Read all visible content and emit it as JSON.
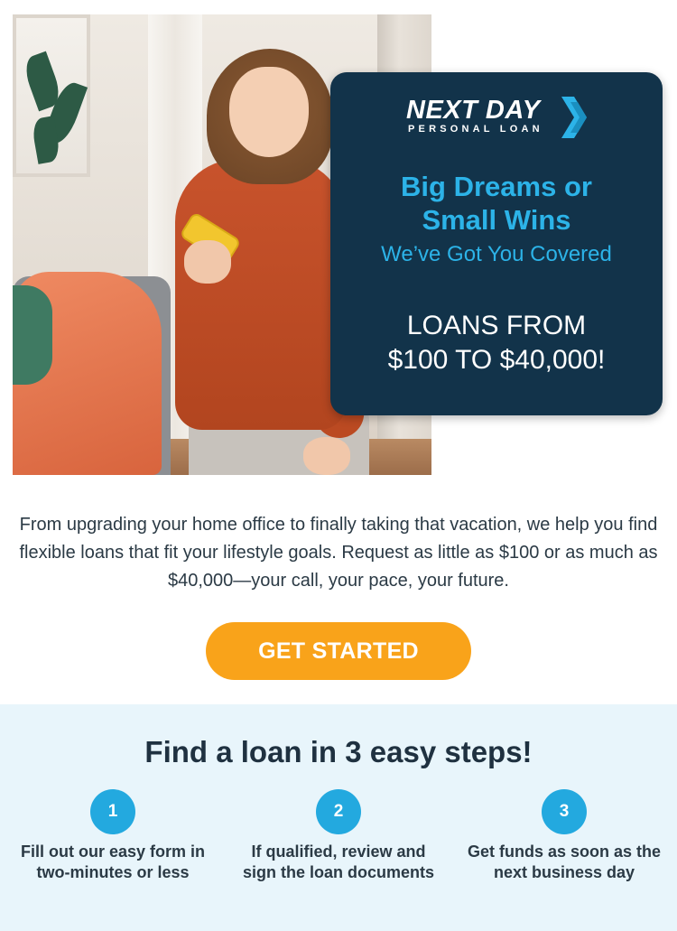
{
  "hero": {
    "photo_alt": "Smiling woman in orange sweater holding a yellow phone"
  },
  "promo": {
    "logo_main": "NEXT DAY",
    "logo_sub": "PERSONAL LOAN",
    "headline_line1": "Big Dreams or",
    "headline_line2": "Small Wins",
    "subheadline": "We’ve Got You Covered",
    "offer_line1": "LOANS FROM",
    "offer_line2": "$100 TO $40,000!"
  },
  "intro": {
    "text": "From upgrading your home office to finally taking that vacation, we help you find flexible loans that fit your lifestyle goals. Request as little as $100 or as much as $40,000—your call, your pace, your future."
  },
  "cta": {
    "label": "GET STARTED"
  },
  "steps": {
    "title": "Find a loan in 3 easy steps!",
    "items": [
      {
        "number": "1",
        "text": "Fill out our easy form in two-minutes or less"
      },
      {
        "number": "2",
        "text": "If qualified, review and sign the loan documents"
      },
      {
        "number": "3",
        "text": "Get funds as soon as the next business day"
      }
    ]
  },
  "colors": {
    "card_bg": "#12334a",
    "accent_blue": "#2cb3e8",
    "cta_orange": "#f9a31a",
    "steps_bg": "#e8f5fb"
  }
}
